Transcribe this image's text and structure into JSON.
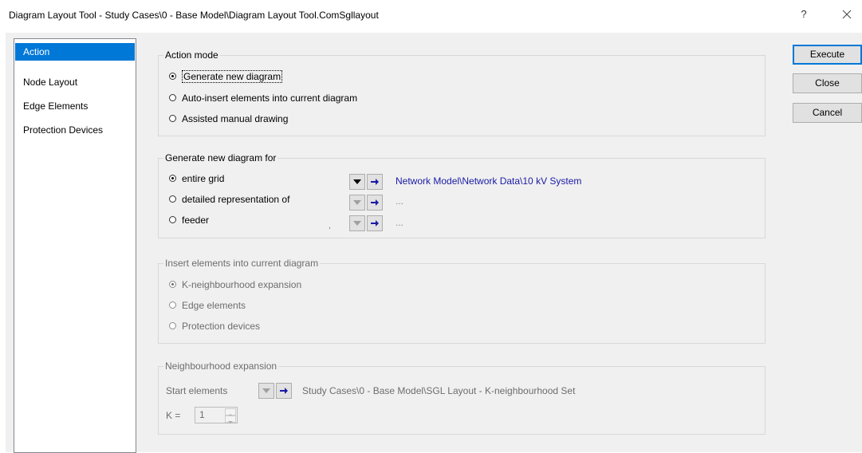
{
  "window": {
    "title": "Diagram Layout Tool - Study Cases\\0 - Base Model\\Diagram Layout Tool.ComSgllayout",
    "help": "?"
  },
  "nav": {
    "items": [
      {
        "label": "Action",
        "selected": true
      },
      {
        "label": "Node Layout"
      },
      {
        "label": "Edge Elements"
      },
      {
        "label": "Protection Devices"
      }
    ]
  },
  "action_mode": {
    "title": "Action mode",
    "options": [
      {
        "label": "Generate new diagram",
        "checked": true
      },
      {
        "label": "Auto-insert elements into current diagram"
      },
      {
        "label": "Assisted manual drawing"
      }
    ]
  },
  "generate_for": {
    "title": "Generate new diagram for",
    "options": [
      {
        "label": "entire grid",
        "checked": true,
        "value": "Network Model\\Network Data\\10 kV System"
      },
      {
        "label": "detailed representation of",
        "value": "..."
      },
      {
        "label": "feeder",
        "value": "..."
      }
    ],
    "stray_mark": ","
  },
  "insert_elements": {
    "title": "Insert elements into current diagram",
    "options": [
      {
        "label": "K-neighbourhood expansion",
        "checked": true
      },
      {
        "label": "Edge elements"
      },
      {
        "label": "Protection devices"
      }
    ]
  },
  "neighbourhood": {
    "title": "Neighbourhood expansion",
    "start_label": "Start elements",
    "start_value": "Study Cases\\0 - Base Model\\SGL Layout - K-neighbourhood Set",
    "k_label": "K =",
    "k_value": "1"
  },
  "buttons": {
    "execute": "Execute",
    "close": "Close",
    "cancel": "Cancel"
  },
  "colors": {
    "accent": "#0078d7",
    "link": "#1a1aa6",
    "dialog_bg": "#f0f0f0"
  }
}
